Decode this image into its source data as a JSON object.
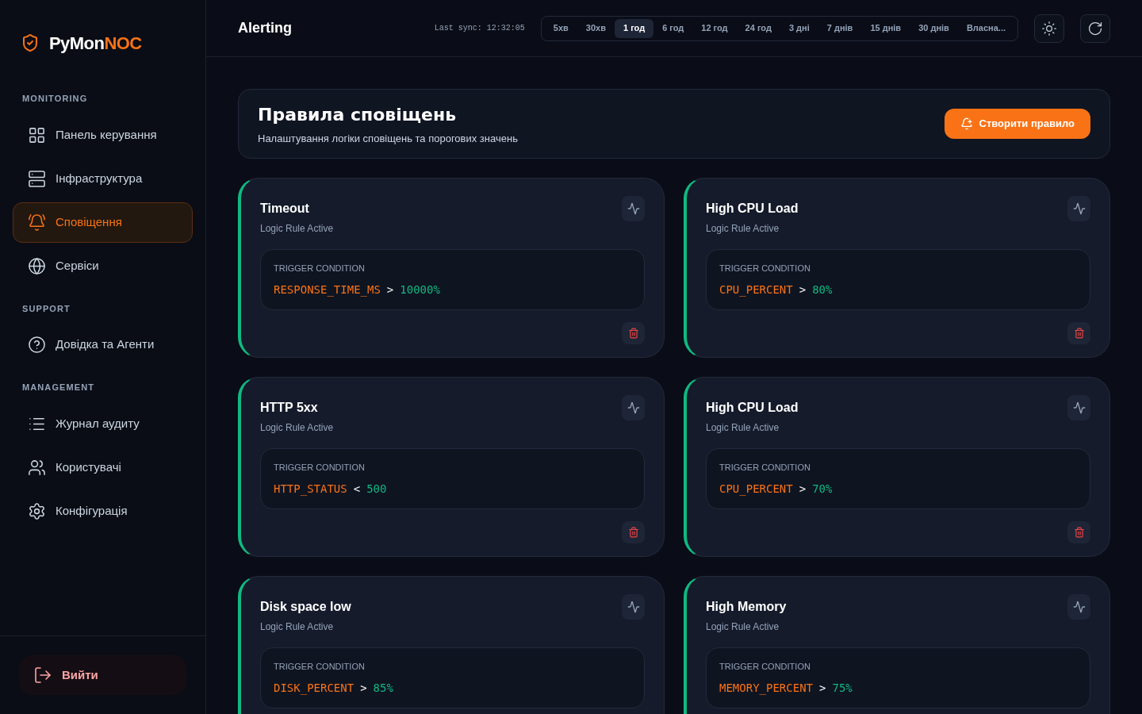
{
  "brand": {
    "name_main": "PyMon",
    "name_accent": "NOC"
  },
  "sidebar": {
    "sections": [
      {
        "heading": "MONITORING",
        "items": [
          {
            "label": "Панель керування",
            "selected": false
          },
          {
            "label": "Інфраструктура",
            "selected": false
          },
          {
            "label": "Сповіщення",
            "selected": true
          },
          {
            "label": "Сервіси",
            "selected": false
          }
        ]
      },
      {
        "heading": "SUPPORT",
        "items": [
          {
            "label": "Довідка та Агенти",
            "selected": false
          }
        ]
      },
      {
        "heading": "MANAGEMENT",
        "items": [
          {
            "label": "Журнал аудиту",
            "selected": false
          },
          {
            "label": "Користувачі",
            "selected": false
          },
          {
            "label": "Конфігурація",
            "selected": false
          }
        ]
      }
    ],
    "logout": "Вийти"
  },
  "header": {
    "title": "Alerting",
    "last_sync": "Last sync: 12:32:05",
    "ranges": [
      {
        "label": "5хв",
        "selected": false
      },
      {
        "label": "30хв",
        "selected": false
      },
      {
        "label": "1 год",
        "selected": true
      },
      {
        "label": "6 год",
        "selected": false
      },
      {
        "label": "12 год",
        "selected": false
      },
      {
        "label": "24 год",
        "selected": false
      },
      {
        "label": "3 дні",
        "selected": false
      },
      {
        "label": "7 днів",
        "selected": false
      },
      {
        "label": "15 днів",
        "selected": false
      },
      {
        "label": "30 днів",
        "selected": false
      },
      {
        "label": "Власна...",
        "selected": false
      }
    ]
  },
  "page": {
    "title": "Правила сповіщень",
    "subtitle": "Налаштування логіки сповіщень та порогових значень",
    "create_button": "Створити правило"
  },
  "rules": [
    {
      "name": "Timeout",
      "status": "Logic Rule Active",
      "condition_label": "TRIGGER CONDITION",
      "metric": "RESPONSE_TIME_MS",
      "operator": ">",
      "value": "10000%",
      "active": true,
      "delete_button": true
    },
    {
      "name": "High CPU Load",
      "status": "Logic Rule Active",
      "condition_label": "TRIGGER CONDITION",
      "metric": "CPU_PERCENT",
      "operator": ">",
      "value": "80%",
      "active": true,
      "delete_button": true
    },
    {
      "name": "HTTP 5xx",
      "status": "Logic Rule Active",
      "condition_label": "TRIGGER CONDITION",
      "metric": "HTTP_STATUS",
      "operator": "<",
      "value": "500",
      "active": true,
      "delete_button": true
    },
    {
      "name": "High CPU Load",
      "status": "Logic Rule Active",
      "condition_label": "TRIGGER CONDITION",
      "metric": "CPU_PERCENT",
      "operator": ">",
      "value": "70%",
      "active": true,
      "delete_button": true
    },
    {
      "name": "Disk space low",
      "status": "Logic Rule Active",
      "condition_label": "TRIGGER CONDITION",
      "metric": "DISK_PERCENT",
      "operator": ">",
      "value": "85%",
      "active": true
    },
    {
      "name": "High Memory",
      "status": "Logic Rule Active",
      "condition_label": "TRIGGER CONDITION",
      "metric": "MEMORY_PERCENT",
      "operator": ">",
      "value": "75%",
      "active": true
    }
  ]
}
